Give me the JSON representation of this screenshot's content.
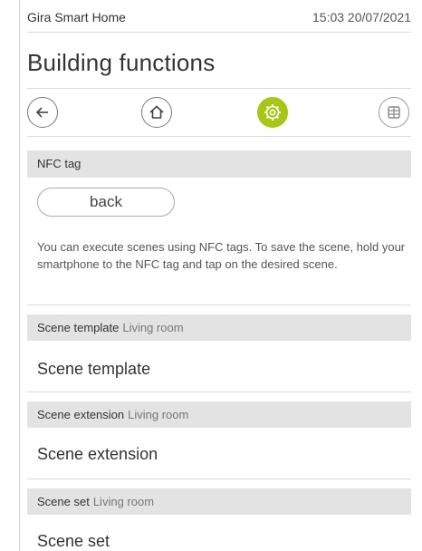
{
  "status_bar": {
    "app_name": "Gira Smart Home",
    "datetime": "15:03 20/07/2021"
  },
  "page": {
    "title": "Building functions"
  },
  "nav": {
    "back_icon": "arrow-left-icon",
    "home_icon": "house-icon",
    "settings_icon": "gear-icon",
    "grid_icon": "grid-icon",
    "active": "settings",
    "accent_color": "#a7c615"
  },
  "nfc": {
    "header": "NFC tag",
    "back_label": "back",
    "info_text": "You can execute scenes using NFC tags. To save the scene, hold your smartphone to the NFC tag and tap on the desired scene."
  },
  "scenes": [
    {
      "header": "Scene template",
      "room": "Living room",
      "label": "Scene template"
    },
    {
      "header": "Scene extension",
      "room": "Living room",
      "label": "Scene extension"
    },
    {
      "header": "Scene set",
      "room": "Living room",
      "label": "Scene set"
    }
  ]
}
